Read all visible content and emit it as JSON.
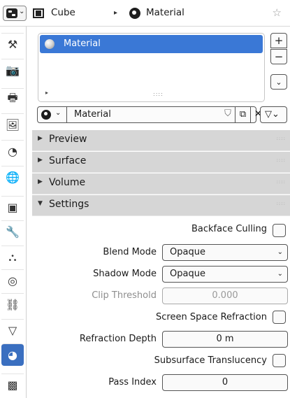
{
  "header": {
    "object_name": "Cube",
    "material_name": "Material",
    "separator": "▸",
    "pin_icon": "pin-icon"
  },
  "tabs": [
    {
      "name": "tool",
      "icon": "⚒"
    },
    {
      "name": "render",
      "icon": "📷"
    },
    {
      "name": "output",
      "icon": "🖶"
    },
    {
      "name": "view-layer",
      "icon": "🖼"
    },
    {
      "name": "scene",
      "icon": "◔"
    },
    {
      "name": "world",
      "icon": "🌐"
    },
    {
      "name": "object",
      "icon": "▣"
    },
    {
      "name": "modifiers",
      "icon": "🔧"
    },
    {
      "name": "particles",
      "icon": "⛬"
    },
    {
      "name": "physics",
      "icon": "◎"
    },
    {
      "name": "constraints",
      "icon": "⛓"
    },
    {
      "name": "object-data",
      "icon": "▽"
    },
    {
      "name": "material",
      "icon": "◕",
      "active": true
    },
    {
      "name": "texture",
      "icon": "▩"
    }
  ],
  "material_slots": {
    "items": [
      "Material"
    ],
    "add_label": "+",
    "remove_label": "−",
    "specials_label": "⌄",
    "expand_label": "▸",
    "grip_label": "::::"
  },
  "material_field": {
    "value": "Material",
    "browse_chevron": "⌄",
    "fake_user_icon": "⛉",
    "duplicate_icon": "⧉",
    "unlink_icon": "✕",
    "assign_icon": "▽⌄"
  },
  "sections": [
    {
      "title": "Preview",
      "expanded": false
    },
    {
      "title": "Surface",
      "expanded": false
    },
    {
      "title": "Volume",
      "expanded": false
    },
    {
      "title": "Settings",
      "expanded": true
    }
  ],
  "section_icons": {
    "collapsed": "▶",
    "expanded": "▼",
    "drag": "::::"
  },
  "settings": {
    "backface_culling": {
      "label": "Backface Culling",
      "checked": false
    },
    "blend_mode": {
      "label": "Blend Mode",
      "value": "Opaque"
    },
    "shadow_mode": {
      "label": "Shadow Mode",
      "value": "Opaque"
    },
    "clip_threshold": {
      "label": "Clip Threshold",
      "value": "0.000",
      "enabled": false
    },
    "screen_space_refraction": {
      "label": "Screen Space Refraction",
      "checked": false
    },
    "refraction_depth": {
      "label": "Refraction Depth",
      "value": "0 m"
    },
    "subsurface_translucency": {
      "label": "Subsurface Translucency",
      "checked": false
    },
    "pass_index": {
      "label": "Pass Index",
      "value": "0"
    },
    "select_chevron": "⌄"
  },
  "colors": {
    "accent": "#3a78d6",
    "active_tab": "#3a6fc0",
    "section_bg": "#d6d6d6"
  }
}
